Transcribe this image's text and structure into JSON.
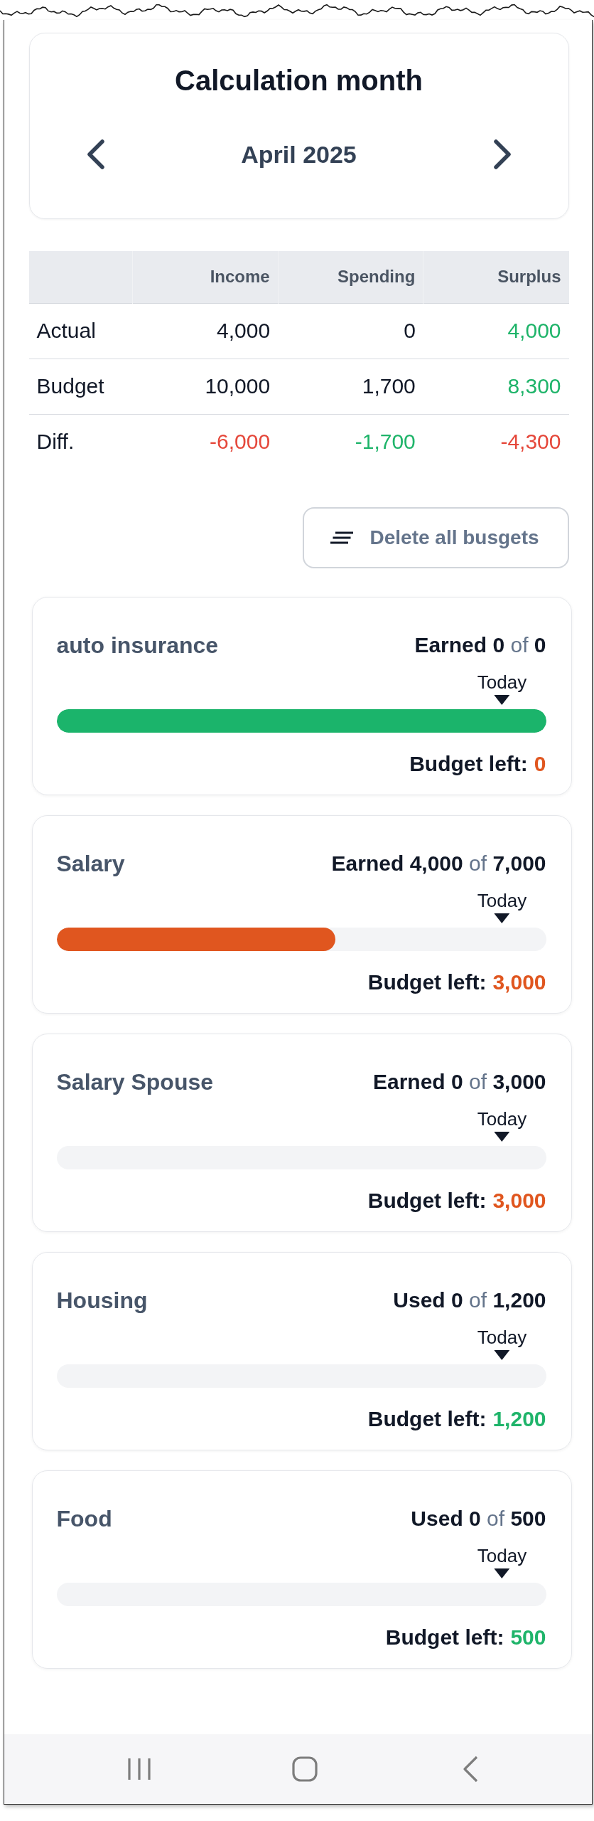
{
  "month_card": {
    "title": "Calculation month",
    "month": "April 2025"
  },
  "summary_table": {
    "columns": [
      "Income",
      "Spending",
      "Surplus"
    ],
    "rows": [
      {
        "label": "Actual",
        "cells": [
          {
            "text": "4,000",
            "color": "#111827"
          },
          {
            "text": "0",
            "color": "#111827"
          },
          {
            "text": "4,000",
            "color": "#1fb46a"
          }
        ]
      },
      {
        "label": "Budget",
        "cells": [
          {
            "text": "10,000",
            "color": "#111827"
          },
          {
            "text": "1,700",
            "color": "#111827"
          },
          {
            "text": "8,300",
            "color": "#1fb46a"
          }
        ]
      },
      {
        "label": "Diff.",
        "cells": [
          {
            "text": "-6,000",
            "color": "#e5483b"
          },
          {
            "text": "-1,700",
            "color": "#1fb46a"
          },
          {
            "text": "-4,300",
            "color": "#e5483b"
          }
        ]
      }
    ]
  },
  "delete_button": {
    "label": "Delete all busgets"
  },
  "budgets": [
    {
      "name": "auto insurance",
      "summary": "**Earned 0** of **0**",
      "today": {
        "label": "Today",
        "level": 0.91
      },
      "bar": {
        "level": 1,
        "color": "#1bb46b"
      },
      "budget_left": {
        "label": "Budget left:",
        "value": "0",
        "color": "#e0561f"
      }
    },
    {
      "name": "Salary",
      "summary": "**Earned 4,000** of **7,000**",
      "today": {
        "label": "Today",
        "level": 0.91
      },
      "bar": {
        "level": 0.57,
        "color": "#e0561f"
      },
      "budget_left": {
        "label": "Budget left:",
        "value": "3,000",
        "color": "#e0561f"
      }
    },
    {
      "name": "Salary Spouse",
      "summary": "**Earned 0** of **3,000**",
      "today": {
        "label": "Today",
        "level": 0.91
      },
      "bar": {
        "level": 0
      },
      "budget_left": {
        "label": "Budget left:",
        "value": "3,000",
        "color": "#e0561f"
      }
    },
    {
      "name": "Housing",
      "summary": "**Used 0** of **1,200**",
      "today": {
        "label": "Today",
        "level": 0.91
      },
      "bar": {
        "level": 0
      },
      "budget_left": {
        "label": "Budget left:",
        "value": "1,200",
        "color": "#1fb46a"
      }
    },
    {
      "name": "Food",
      "summary": "**Used 0** of **500**",
      "today": {
        "label": "Today",
        "level": 0.91
      },
      "bar": {
        "level": 0
      },
      "budget_left": {
        "label": "Budget left:",
        "value": "500",
        "color": "#1fb46a"
      }
    }
  ]
}
